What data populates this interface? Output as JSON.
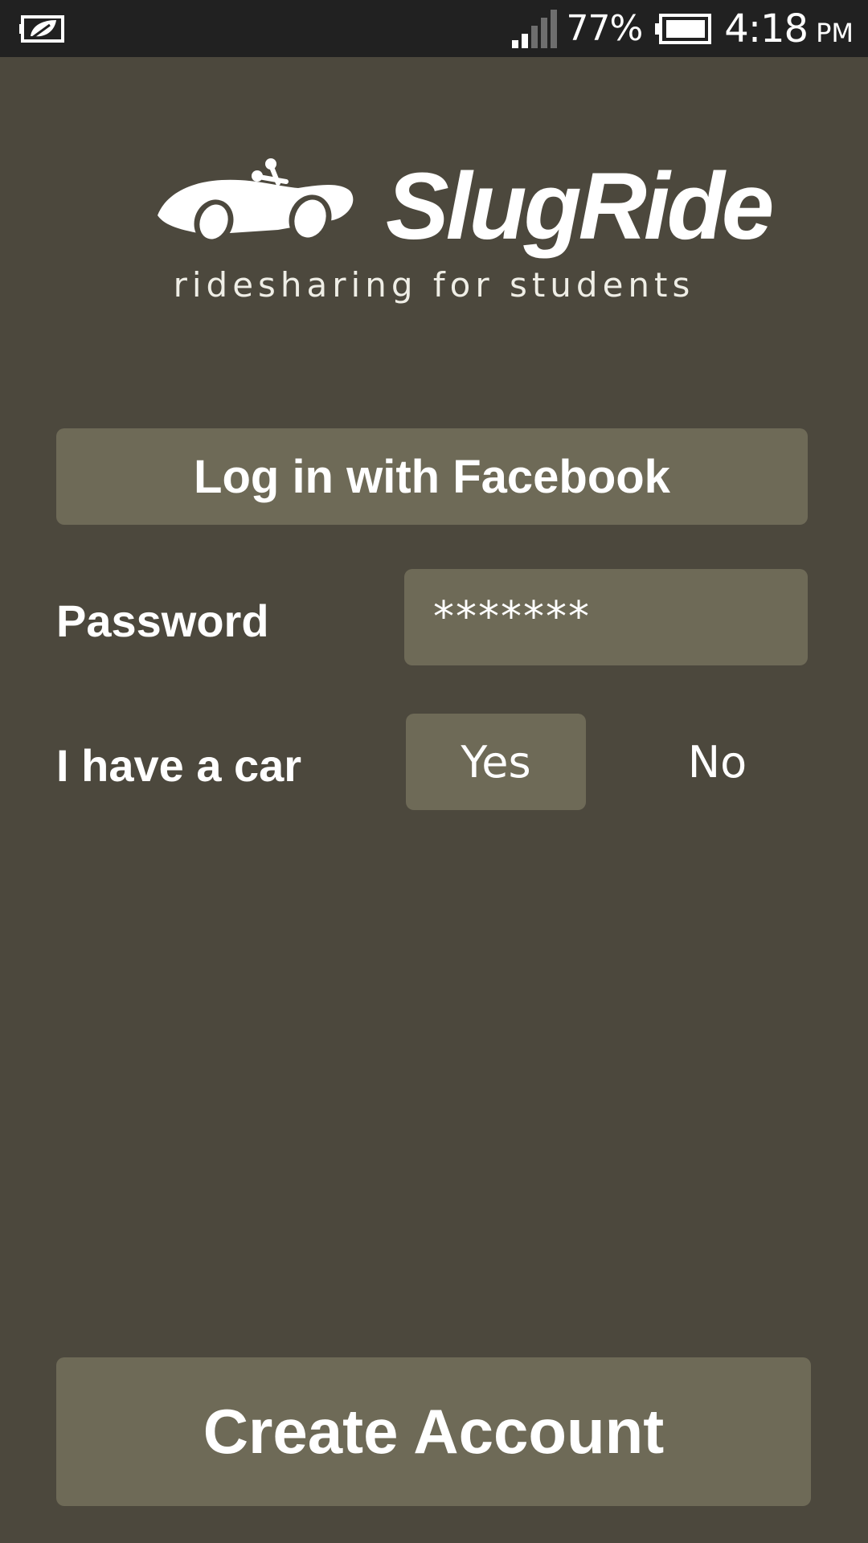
{
  "status_bar": {
    "left_icon": "leaf-battery-icon",
    "signal_icon": "signal-icon",
    "battery_percent": "77%",
    "battery_icon": "battery-icon",
    "time": "4:18",
    "ampm": "PM"
  },
  "logo": {
    "icon": "slug-car-icon",
    "title": "SlugRide",
    "tagline": "ridesharing for students"
  },
  "login": {
    "facebook_label": "Log in with Facebook"
  },
  "form": {
    "password_label": "Password",
    "password_value": "*******",
    "car_label": "I have a car",
    "car_yes": "Yes",
    "car_no": "No",
    "car_selected": "Yes"
  },
  "actions": {
    "create_account_label": "Create Account"
  },
  "colors": {
    "background": "#4c483d",
    "status_bar": "#212121",
    "button": "#6e6a57",
    "text": "#ffffff"
  }
}
